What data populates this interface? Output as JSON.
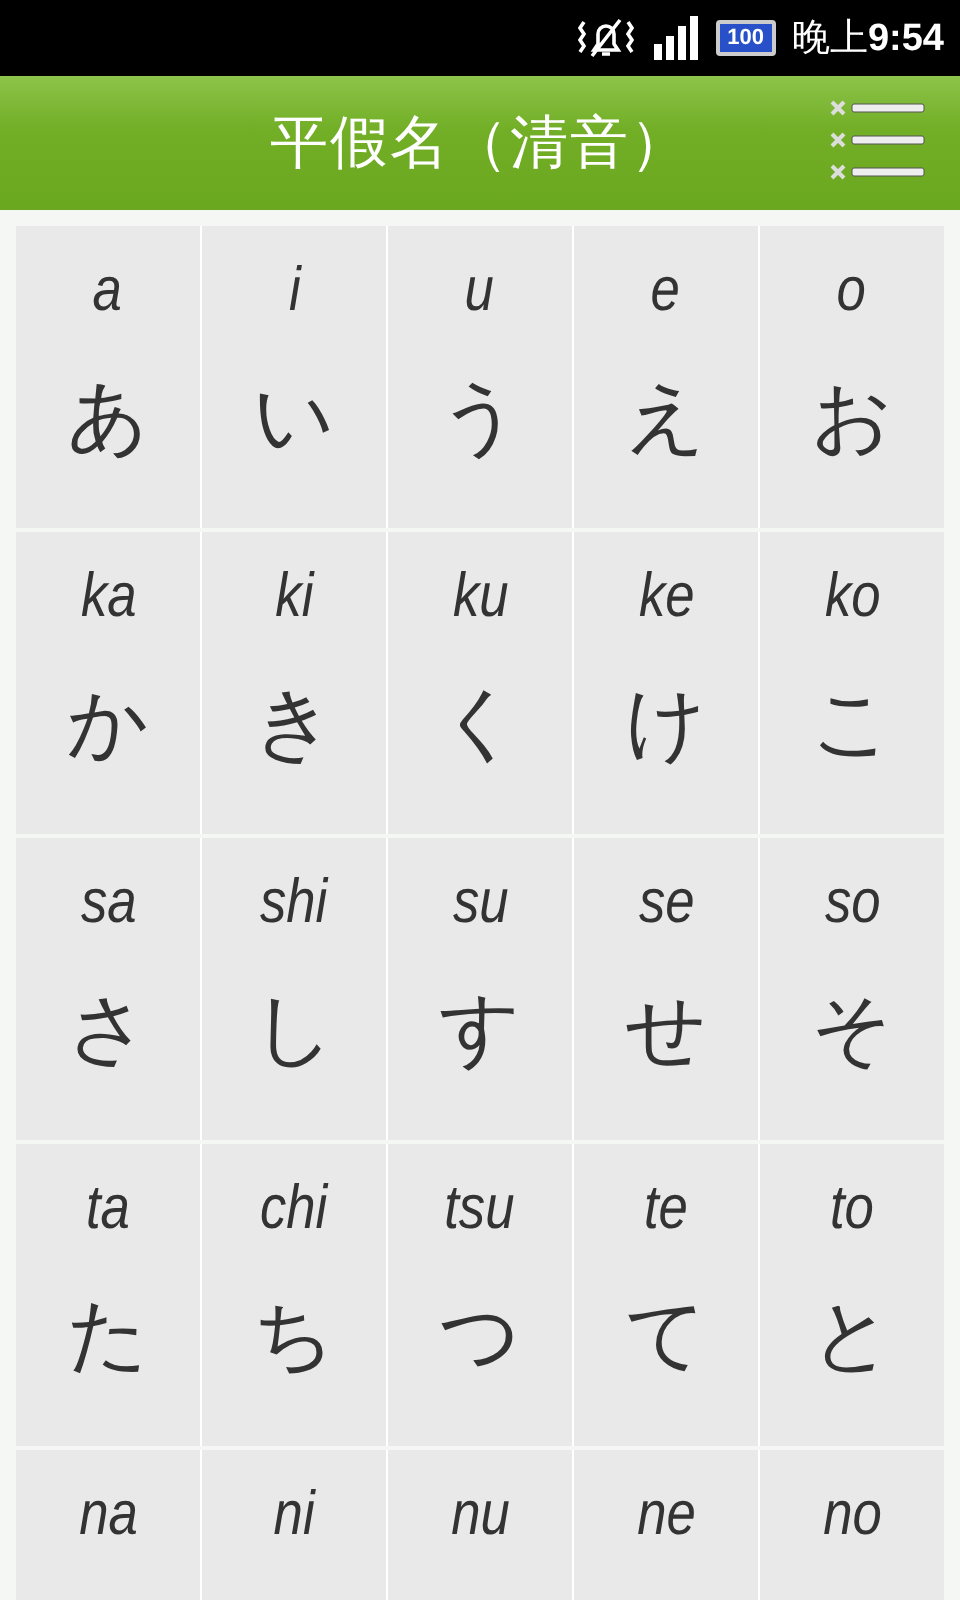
{
  "status_bar": {
    "battery": "100",
    "time": "晚上**9:54**"
  },
  "header": {
    "title": "平假名（清音）"
  },
  "rows": [
    {
      "cells": [
        {
          "romaji": "a",
          "kana": "あ"
        },
        {
          "romaji": "i",
          "kana": "い"
        },
        {
          "romaji": "u",
          "kana": "う"
        },
        {
          "romaji": "e",
          "kana": "え"
        },
        {
          "romaji": "o",
          "kana": "お"
        }
      ]
    },
    {
      "cells": [
        {
          "romaji": "ka",
          "kana": "か"
        },
        {
          "romaji": "ki",
          "kana": "き"
        },
        {
          "romaji": "ku",
          "kana": "く"
        },
        {
          "romaji": "ke",
          "kana": "け"
        },
        {
          "romaji": "ko",
          "kana": "こ"
        }
      ]
    },
    {
      "cells": [
        {
          "romaji": "sa",
          "kana": "さ"
        },
        {
          "romaji": "shi",
          "kana": "し"
        },
        {
          "romaji": "su",
          "kana": "す"
        },
        {
          "romaji": "se",
          "kana": "せ"
        },
        {
          "romaji": "so",
          "kana": "そ"
        }
      ]
    },
    {
      "cells": [
        {
          "romaji": "ta",
          "kana": "た"
        },
        {
          "romaji": "chi",
          "kana": "ち"
        },
        {
          "romaji": "tsu",
          "kana": "つ"
        },
        {
          "romaji": "te",
          "kana": "て"
        },
        {
          "romaji": "to",
          "kana": "と"
        }
      ]
    },
    {
      "cells": [
        {
          "romaji": "na"
        },
        {
          "romaji": "ni"
        },
        {
          "romaji": "nu"
        },
        {
          "romaji": "ne"
        },
        {
          "romaji": "no"
        }
      ]
    }
  ]
}
